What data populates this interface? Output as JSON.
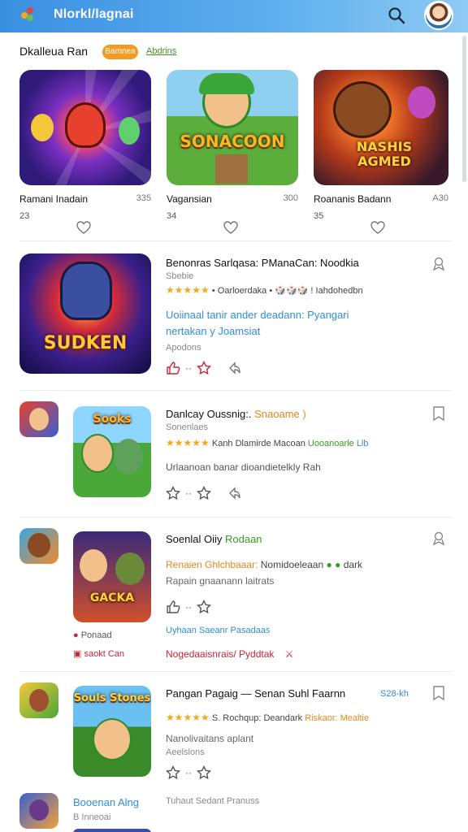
{
  "header": {
    "title": "Nlorkl/lagnai"
  },
  "featured_section": {
    "title": "Dkalleua Ran",
    "pill": "Bamnea",
    "link": "Abdrins",
    "items": [
      {
        "art_text": "",
        "name": "Ramani Inadain",
        "size": "335",
        "num": "23"
      },
      {
        "art_text": "SONACOON",
        "name": "Vagansian",
        "size": "300",
        "num": "34"
      },
      {
        "art_text": "NASHIS AGMED",
        "name": "Roananis Badann",
        "size": "A30",
        "num": "35"
      }
    ]
  },
  "list": [
    {
      "art_text": "SUDKEN",
      "title": "Benonras Sarlqasa: PManaCan: Noodkia",
      "sub": "Sbebie",
      "stars": "★★★★★",
      "meta": "• Oarloerdaka • 🎲🎲🎲 ! Iahdohedbn",
      "desc1": "Uoiinaal tanir ander deadann: Pyangari",
      "desc2": "nertakan y Joamsiat",
      "extra": "Apodons"
    },
    {
      "art_text": "Sooks",
      "title": "Danlcay Oussnig:.",
      "title_accent": "Snaoame )",
      "sub": "Sonenlaes",
      "stars": "★★★★★",
      "meta": "Kanh Dlamirde Macoan",
      "meta_accent": "Uooanoarle",
      "meta_tail": "Llb",
      "desc1": "Urlaanoan banar dioandietelkly Rah"
    },
    {
      "art_text": "GACKA",
      "title": "Soenlal Oiiy",
      "title_accent": "Rodaan",
      "meta_orange": "Renaien Ghlchbaaar:",
      "meta": "Nomidoeleaan",
      "meta_tail": "dark",
      "sub": "Rapain gnaanann laitrats",
      "link_blue": "Uyhaan Saeanr Pasadaas",
      "extra1": "Ponaad",
      "extra2": "saokt Can",
      "red_text": "Nogedaaisnrais/ Pyddtak"
    },
    {
      "art_text": "Souls Stones",
      "title": "Pangan Pagaig — Senan Suhl Faarnn",
      "right_tag": "S28-kh",
      "stars": "★★★★★",
      "meta": "S. Rochqup: Deandark",
      "meta_orange": "Riskaor: Mealtie",
      "sub": "Nanolivaitans aplant",
      "sub2": "Aeelslons"
    },
    {
      "title": "Booenan Alng",
      "sub": "B Inneoai",
      "meta": "Tuhaut Sedant Pranuss"
    }
  ],
  "colors": {
    "accent": "#3a8fe0",
    "star": "#f4a81d",
    "pill": "#f49a22"
  }
}
